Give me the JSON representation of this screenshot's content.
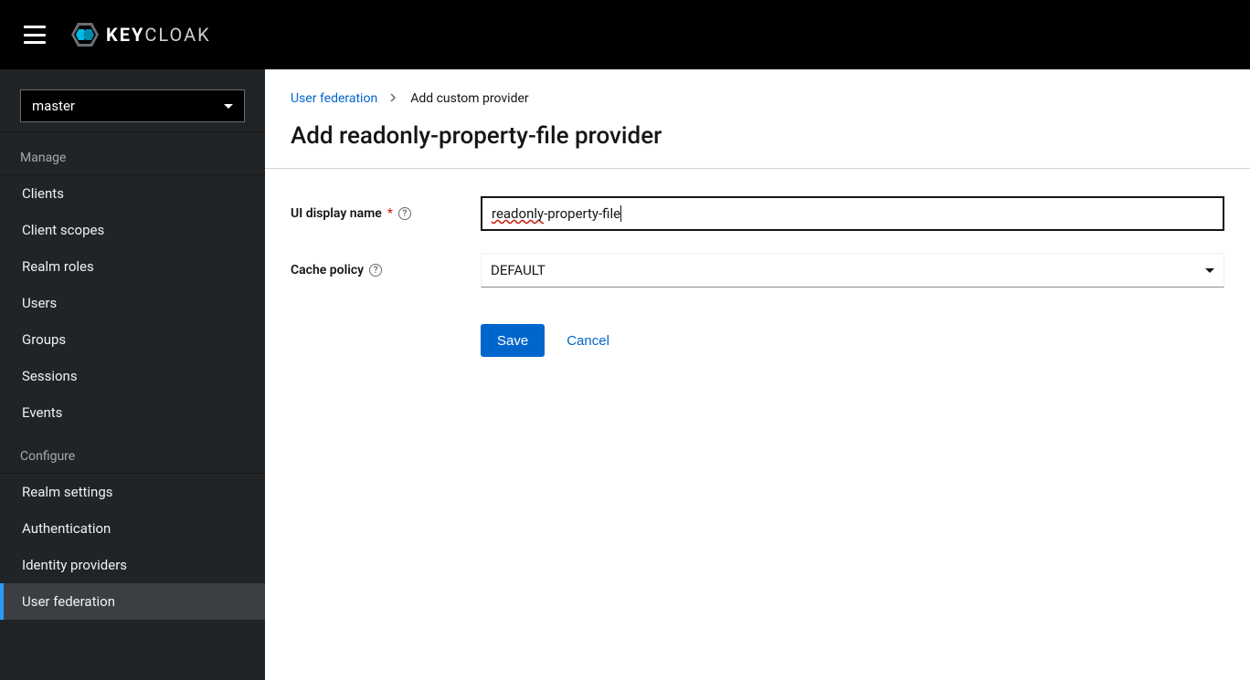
{
  "header": {
    "brand_prefix": "KEY",
    "brand_suffix": "CLOAK"
  },
  "sidebar": {
    "realm_selected": "master",
    "sections": [
      {
        "title": "Manage",
        "items": [
          {
            "label": "Clients",
            "active": false
          },
          {
            "label": "Client scopes",
            "active": false
          },
          {
            "label": "Realm roles",
            "active": false
          },
          {
            "label": "Users",
            "active": false
          },
          {
            "label": "Groups",
            "active": false
          },
          {
            "label": "Sessions",
            "active": false
          },
          {
            "label": "Events",
            "active": false
          }
        ]
      },
      {
        "title": "Configure",
        "items": [
          {
            "label": "Realm settings",
            "active": false
          },
          {
            "label": "Authentication",
            "active": false
          },
          {
            "label": "Identity providers",
            "active": false
          },
          {
            "label": "User federation",
            "active": true
          }
        ]
      }
    ]
  },
  "breadcrumb": {
    "parent": "User federation",
    "current": "Add custom provider"
  },
  "page": {
    "title": "Add readonly-property-file provider"
  },
  "form": {
    "display_name": {
      "label": "UI display name",
      "value_spelled": "readonly",
      "value_rest": "-property-file"
    },
    "cache_policy": {
      "label": "Cache policy",
      "value": "DEFAULT"
    },
    "actions": {
      "save": "Save",
      "cancel": "Cancel"
    }
  }
}
